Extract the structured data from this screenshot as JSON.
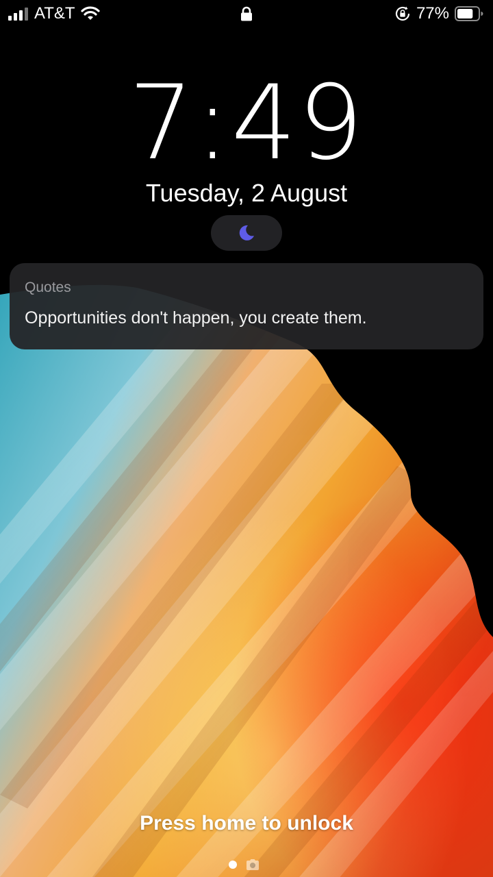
{
  "status_bar": {
    "carrier": "AT&T",
    "signal_icon": "cellular-signal-icon",
    "wifi_icon": "wifi-icon",
    "lock_icon": "lock-icon",
    "rotation_lock_icon": "rotation-lock-icon",
    "battery_percent": "77%",
    "battery_icon": "battery-icon",
    "battery_level": 0.77
  },
  "lock_screen": {
    "time": "7:49",
    "date": "Tuesday, 2 August",
    "focus_icon": "moon-icon",
    "focus_color": "#5e5ce6"
  },
  "notification": {
    "app": "Quotes",
    "body": "Opportunities don't happen, you create them."
  },
  "bottom": {
    "unlock_hint": "Press home to unlock",
    "camera_icon": "camera-icon"
  }
}
